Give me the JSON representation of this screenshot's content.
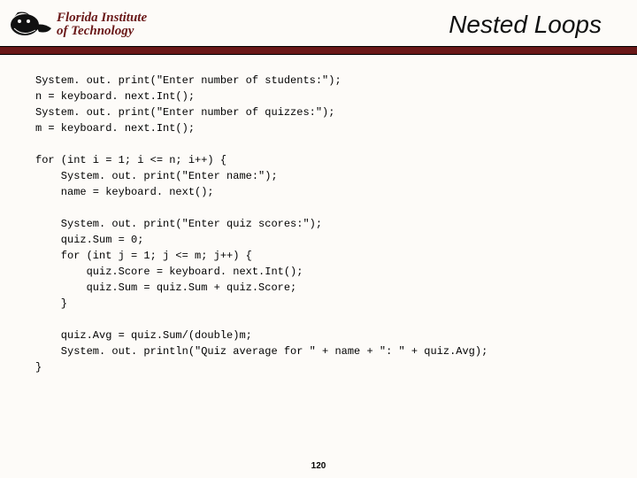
{
  "header": {
    "org_line1": "Florida Institute",
    "org_line2": "of Technology",
    "title": "Nested Loops"
  },
  "code": {
    "l01": "System. out. print(\"Enter number of students:\");",
    "l02": "n = keyboard. next.Int();",
    "l03": "System. out. print(\"Enter number of quizzes:\");",
    "l04": "m = keyboard. next.Int();",
    "l05": "",
    "l06": "for (int i = 1; i <= n; i++) {",
    "l07": "    System. out. print(\"Enter name:\");",
    "l08": "    name = keyboard. next();",
    "l09": "",
    "l10": "    System. out. print(\"Enter quiz scores:\");",
    "l11": "    quiz.Sum = 0;",
    "l12": "    for (int j = 1; j <= m; j++) {",
    "l13": "        quiz.Score = keyboard. next.Int();",
    "l14": "        quiz.Sum = quiz.Sum + quiz.Score;",
    "l15": "    }",
    "l16": "",
    "l17": "    quiz.Avg = quiz.Sum/(double)m;",
    "l18": "    System. out. println(\"Quiz average for \" + name + \": \" + quiz.Avg);",
    "l19": "}"
  },
  "page_number": "120"
}
